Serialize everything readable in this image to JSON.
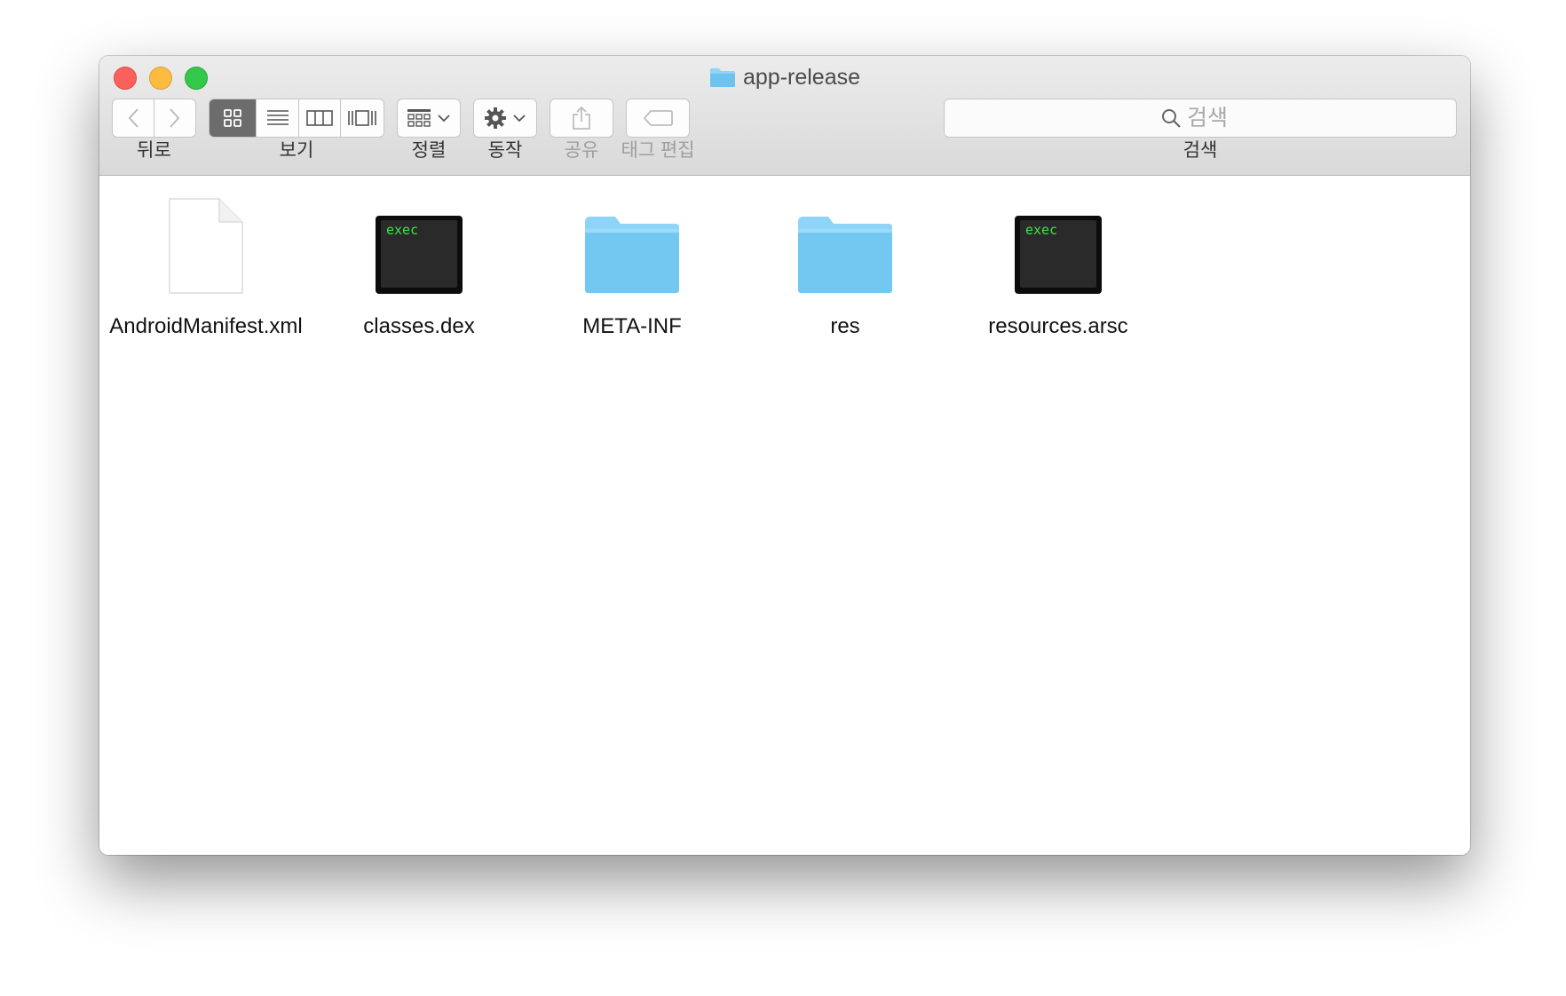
{
  "window": {
    "title": "app-release"
  },
  "toolbar": {
    "back_label": "뒤로",
    "view_label": "보기",
    "arrange_label": "정렬",
    "action_label": "동작",
    "share_label": "공유",
    "tags_label": "태그 편집",
    "search_label": "검색",
    "search_placeholder": "검색"
  },
  "files": [
    {
      "name": "AndroidManifest.xml",
      "icon": "document-icon",
      "kind": "document"
    },
    {
      "name": "classes.dex",
      "icon": "exec-terminal-icon",
      "kind": "executable",
      "badge": "exec"
    },
    {
      "name": "META-INF",
      "icon": "folder-icon",
      "kind": "folder"
    },
    {
      "name": "res",
      "icon": "folder-icon",
      "kind": "folder"
    },
    {
      "name": "resources.arsc",
      "icon": "exec-terminal-icon",
      "kind": "executable",
      "badge": "exec"
    }
  ],
  "colors": {
    "close": "#fc605b",
    "minimize": "#fdbc40",
    "maximize": "#34c84a",
    "folder": "#74c9f5",
    "exec_text": "#3ee24a",
    "terminal_bg": "#222222"
  }
}
